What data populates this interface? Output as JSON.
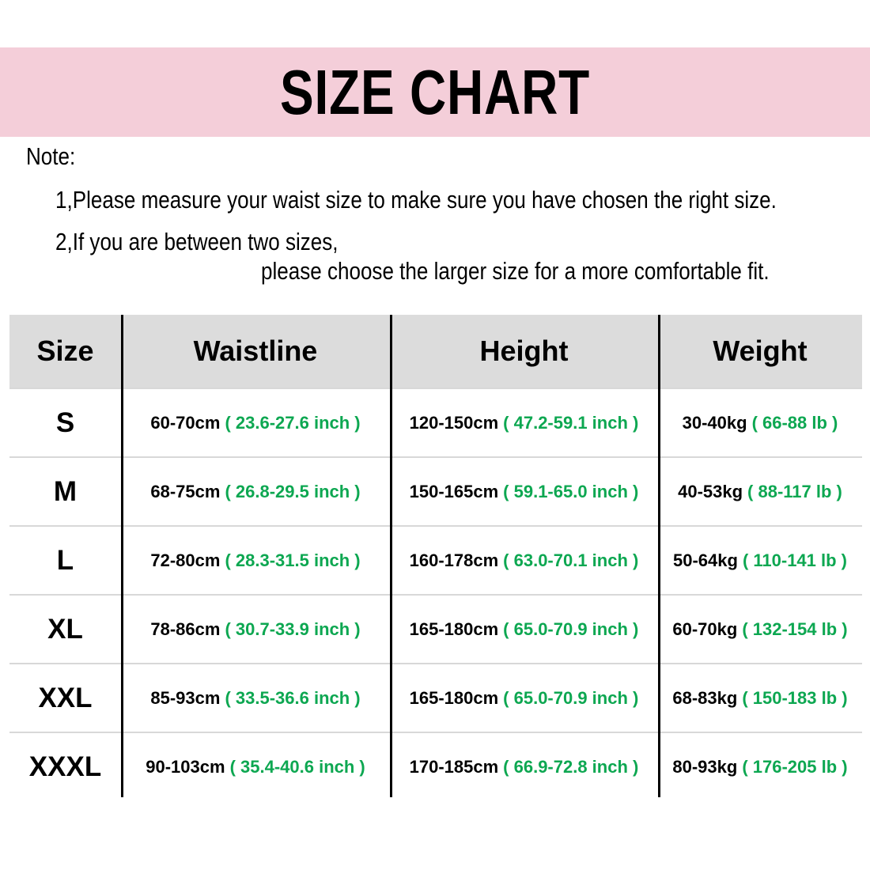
{
  "banner": {
    "title": "SIZE CHART",
    "background_color": "#f4ced9"
  },
  "note": {
    "heading": "Note:",
    "line1": "1,Please measure your waist size to make sure you have chosen the right size.",
    "line2": "2,If you are between two sizes,",
    "line2_cont": "please choose the larger size for a more comfortable fit."
  },
  "table": {
    "header_background": "#dcdcdc",
    "metric_color": "#000000",
    "imperial_color": "#0da751",
    "columns": [
      {
        "key": "size",
        "label": "Size"
      },
      {
        "key": "waistline",
        "label": "Waistline"
      },
      {
        "key": "height",
        "label": "Height"
      },
      {
        "key": "weight",
        "label": "Weight"
      }
    ],
    "rows": [
      {
        "size": "S",
        "waistline_metric": "60-70cm",
        "waistline_imperial": "( 23.6-27.6 inch )",
        "height_metric": "120-150cm",
        "height_imperial": "( 47.2-59.1 inch )",
        "weight_metric": "30-40kg",
        "weight_imperial": "( 66-88 lb )"
      },
      {
        "size": "M",
        "waistline_metric": "68-75cm",
        "waistline_imperial": "( 26.8-29.5 inch )",
        "height_metric": "150-165cm",
        "height_imperial": "( 59.1-65.0 inch )",
        "weight_metric": "40-53kg",
        "weight_imperial": "( 88-117 lb )"
      },
      {
        "size": "L",
        "waistline_metric": "72-80cm",
        "waistline_imperial": "( 28.3-31.5 inch )",
        "height_metric": "160-178cm",
        "height_imperial": "( 63.0-70.1 inch )",
        "weight_metric": "50-64kg",
        "weight_imperial": "( 110-141 lb )"
      },
      {
        "size": "XL",
        "waistline_metric": "78-86cm",
        "waistline_imperial": "( 30.7-33.9 inch )",
        "height_metric": "165-180cm",
        "height_imperial": "( 65.0-70.9 inch )",
        "weight_metric": "60-70kg",
        "weight_imperial": "( 132-154 lb )"
      },
      {
        "size": "XXL",
        "waistline_metric": "85-93cm",
        "waistline_imperial": "( 33.5-36.6 inch )",
        "height_metric": "165-180cm",
        "height_imperial": "( 65.0-70.9 inch )",
        "weight_metric": "68-83kg",
        "weight_imperial": "( 150-183 lb )"
      },
      {
        "size": "XXXL",
        "waistline_metric": "90-103cm",
        "waistline_imperial": "( 35.4-40.6 inch )",
        "height_metric": "170-185cm",
        "height_imperial": "( 66.9-72.8 inch )",
        "weight_metric": "80-93kg",
        "weight_imperial": "( 176-205 lb )"
      }
    ]
  }
}
